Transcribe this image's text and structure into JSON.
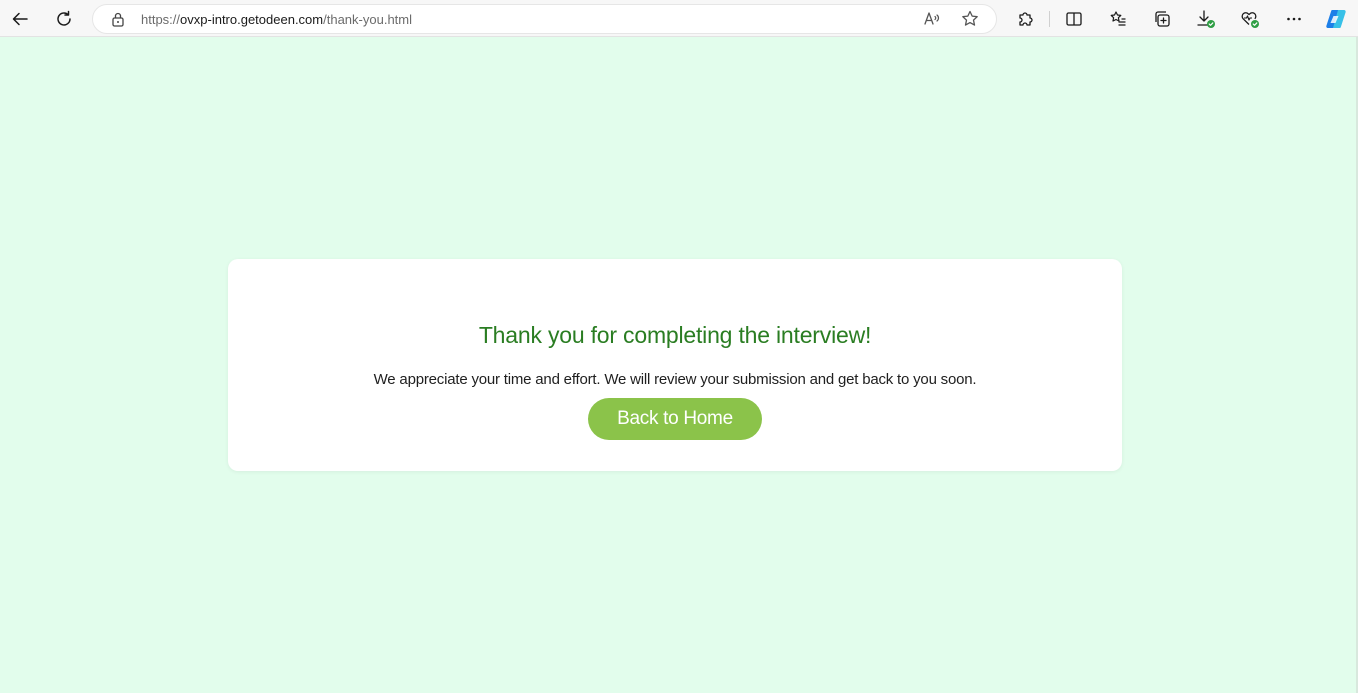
{
  "browser": {
    "url_scheme": "https://",
    "url_host": "ovxp-intro.getodeen.com",
    "url_path": "/thank-you.html"
  },
  "card": {
    "title": "Thank you for completing the interview!",
    "message": "We appreciate your time and effort. We will review your submission and get back to you soon.",
    "button_label": "Back to Home"
  },
  "colors": {
    "page_background": "#e2fdec",
    "title_green": "#2a7d22",
    "button_green": "#8bc34a"
  }
}
